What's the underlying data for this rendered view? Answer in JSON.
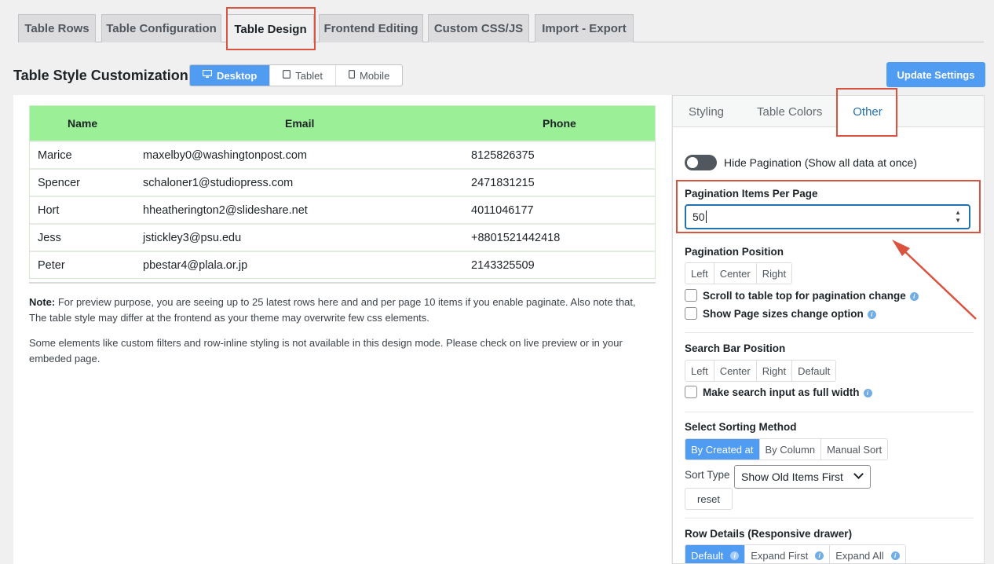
{
  "top_tabs": [
    {
      "label": "Table Rows"
    },
    {
      "label": "Table Configuration"
    },
    {
      "label": "Table Design"
    },
    {
      "label": "Frontend Editing"
    },
    {
      "label": "Custom CSS/JS"
    },
    {
      "label": "Import - Export"
    }
  ],
  "header": {
    "title": "Table Style Customization",
    "devices": [
      {
        "label": "Desktop",
        "icon": "desktop-icon",
        "active": true
      },
      {
        "label": "Tablet",
        "icon": "tablet-icon",
        "active": false
      },
      {
        "label": "Mobile",
        "icon": "mobile-icon",
        "active": false
      }
    ],
    "update_label": "Update Settings"
  },
  "preview": {
    "columns": [
      "Name",
      "Email",
      "Phone"
    ],
    "rows": [
      [
        "Marice",
        "maxelby0@washingtonpost.com",
        "8125826375"
      ],
      [
        "Spencer",
        "schaloner1@studiopress.com",
        "2471831215"
      ],
      [
        "Hort",
        "hheatherington2@slideshare.net",
        "4011046177"
      ],
      [
        "Jess",
        "jstickley3@psu.edu",
        "+8801521442418"
      ],
      [
        "Peter",
        "pbestar4@plala.or.jp",
        "2143325509"
      ]
    ],
    "note_label": "Note:",
    "note_text": "For preview purpose, you are seeing up to 25 latest rows here and and per page 10 items if you enable paginate. Also note that, The table style may differ at the frontend as your theme may overwrite few css elements.",
    "note2": "Some elements like custom filters and row-inline styling is not available in this design mode. Please check on live preview or in your embeded page."
  },
  "settings": {
    "tabs": [
      "Styling",
      "Table Colors",
      "Other"
    ],
    "hide_pagination": "Hide Pagination (Show all data at once)",
    "items_per_page_label": "Pagination Items Per Page",
    "items_per_page_value": "50",
    "pagination_position_label": "Pagination Position",
    "pagination_position": [
      "Left",
      "Center",
      "Right"
    ],
    "scroll_top": "Scroll to table top for pagination change",
    "show_page_sizes": "Show Page sizes change option",
    "search_bar_label": "Search Bar Position",
    "search_bar_position": [
      "Left",
      "Center",
      "Right",
      "Default"
    ],
    "search_full_width": "Make search input as full width",
    "sorting_label": "Select Sorting Method",
    "sorting_methods": [
      "By Created at",
      "By Column",
      "Manual Sort"
    ],
    "sort_type_label": "Sort Type",
    "sort_type_value": "Show Old Items First",
    "reset_label": "reset",
    "row_details_label": "Row Details (Responsive drawer)",
    "row_details": [
      "Default",
      "Expand First",
      "Expand All"
    ]
  },
  "colors": {
    "accent": "#4f9cf2",
    "header_green": "#9bef96",
    "highlight_red": "#d9533f"
  }
}
